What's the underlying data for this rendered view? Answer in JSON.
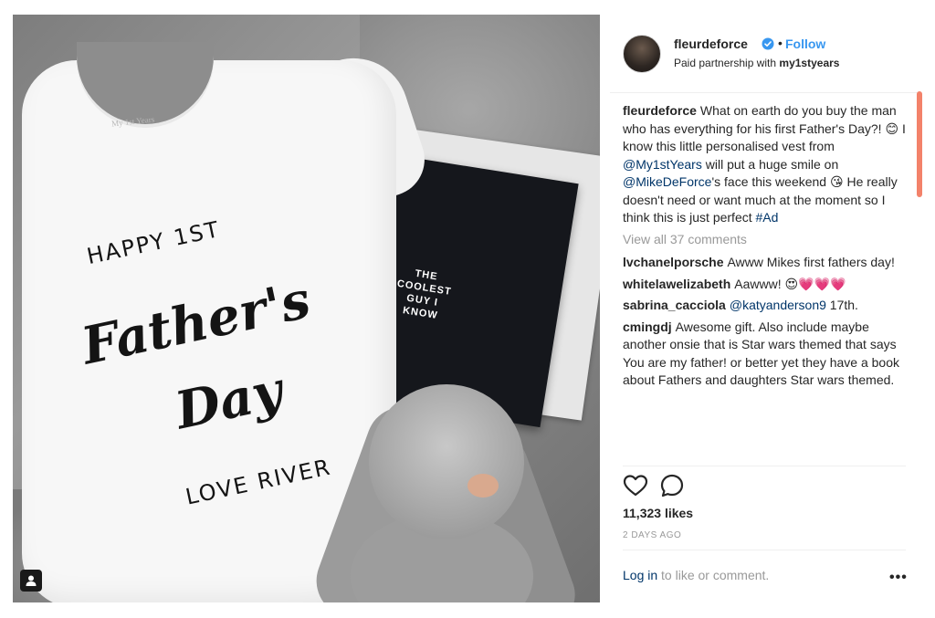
{
  "post": {
    "image_alt": "",
    "onesie": {
      "brand": "My 1st Years",
      "line1": "HAPPY 1ST",
      "line2": "Father's",
      "line3": "Day",
      "line4": "LOVE RIVER"
    },
    "card_text": "THE COOLEST GUY I KNOW"
  },
  "header": {
    "username": "fleurdeforce",
    "separator": "•",
    "follow_label": "Follow",
    "partnership_prefix": "Paid partnership with ",
    "partnership_brand": "my1styears"
  },
  "caption": {
    "user": "fleurdeforce",
    "text_a": "What on earth do you buy the man who has everything for his first Father's Day?! 😊 I know this little personalised vest from ",
    "mention1": "@My1stYears",
    "text_b": " will put a huge smile on ",
    "mention2": "@MikeDeForce",
    "text_c": "'s face this weekend 😘 He really doesn't need or want much at the moment so I think this is just perfect ",
    "hashtag": "#Ad"
  },
  "view_all": "View all 37 comments",
  "comments": [
    {
      "user": "lvchanelporsche",
      "text": "Awww Mikes first fathers day!"
    },
    {
      "user": "whitelawelizabeth",
      "text": "Aawww! 😍💗💗💗"
    },
    {
      "user": "sabrina_cacciola",
      "mention": "@katyanderson9",
      "text": " 17th."
    },
    {
      "user": "cmingdj",
      "text": "Awesome gift. Also include maybe another onsie that is Star wars themed that says You are my father! or better yet they have a book about Fathers and daughters Star wars themed."
    }
  ],
  "likes": "11,323 likes",
  "timestamp": "2 DAYS AGO",
  "login": {
    "link": "Log in",
    "suffix": " to like or comment."
  },
  "more_label": "•••",
  "colors": {
    "link": "#003569",
    "follow": "#3897f0",
    "muted": "#999999",
    "scroll": "#f3826a"
  }
}
